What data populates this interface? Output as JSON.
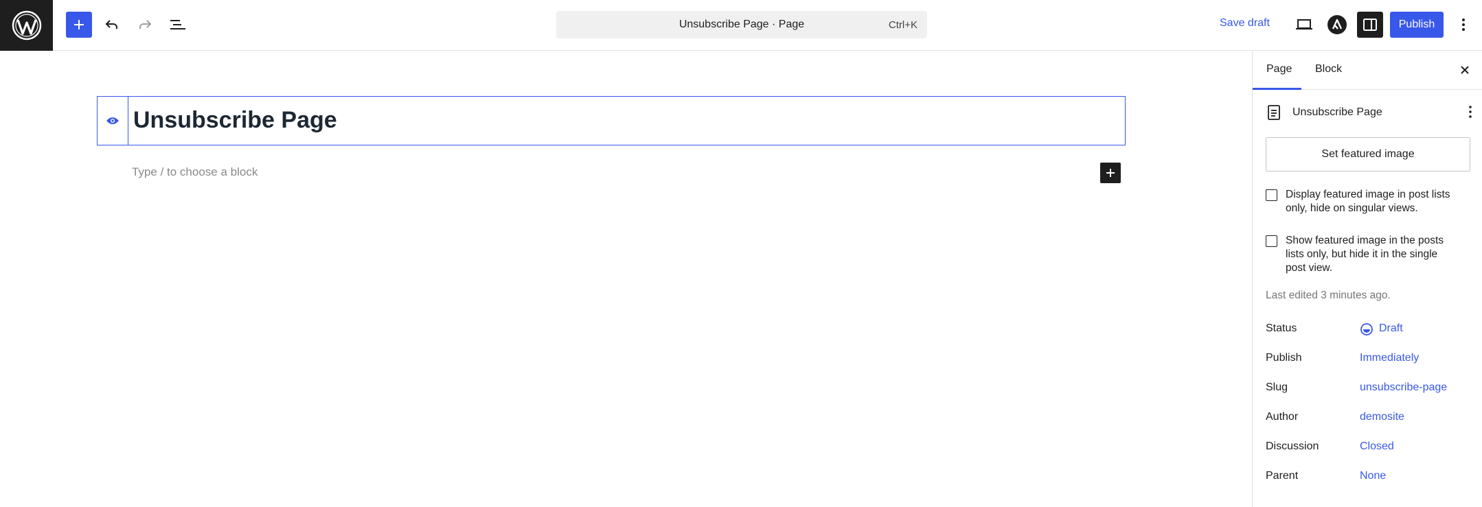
{
  "toolbar": {
    "document_title": "Unsubscribe Page · Page",
    "shortcut": "Ctrl+K",
    "save_draft": "Save draft",
    "publish": "Publish"
  },
  "editor": {
    "page_title": "Unsubscribe Page",
    "block_placeholder": "Type / to choose a block"
  },
  "sidebar": {
    "tabs": [
      {
        "label": "Page",
        "active": true
      },
      {
        "label": "Block",
        "active": false
      }
    ],
    "document_name": "Unsubscribe Page",
    "set_featured_image": "Set featured image",
    "checkbox_1": "Display featured image in post lists only, hide on singular views.",
    "checkbox_2": "Show featured image in the posts lists only, but hide it in the single post view.",
    "last_edited": "Last edited 3 minutes ago.",
    "meta": [
      {
        "label": "Status",
        "value": "Draft"
      },
      {
        "label": "Publish",
        "value": "Immediately"
      },
      {
        "label": "Slug",
        "value": "unsubscribe-page"
      },
      {
        "label": "Author",
        "value": "demosite"
      },
      {
        "label": "Discussion",
        "value": "Closed"
      },
      {
        "label": "Parent",
        "value": "None"
      }
    ]
  },
  "colors": {
    "accent": "#3858e9",
    "dark": "#1e1e1e"
  }
}
